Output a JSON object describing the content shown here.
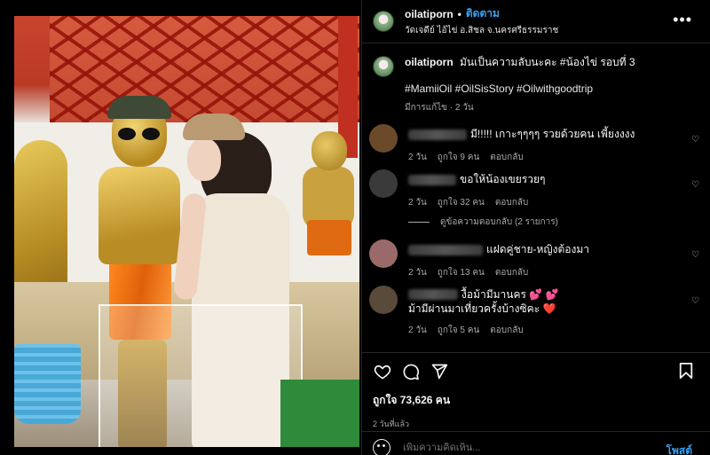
{
  "post": {
    "username": "oilatiporn",
    "follow_label": "ติดตาม",
    "location": "วัดเจดีย์ ไอ้ไข่ อ.สิชล จ.นครศรีธรรมราช",
    "more_icon": "more-horizontal-icon"
  },
  "caption": {
    "username": "oilatiporn",
    "text": "มันเป็นความลับนะคะ #น้องไข่ รอบที่ 3",
    "tags": "#MamiiOil #OilSisStory #Oilwithgoodtrip",
    "meta": "มีการแก้ไข · 2 วัน"
  },
  "comments": [
    {
      "text": "มี!!!!! เกาะๆๆๆๆ รวยด้วยคน เพี้ยงงงง",
      "time": "2 วัน",
      "likes": "ถูกใจ 9 คน",
      "reply": "ตอบกลับ",
      "avatar_color": "#6b4a2a"
    },
    {
      "text": "ขอให้น้องเขยรวยๆ",
      "time": "2 วัน",
      "likes": "ถูกใจ 32 คน",
      "reply": "ตอบกลับ",
      "avatar_color": "#3a3a3a"
    },
    {
      "text": "แฝดคู่ชาย-หญิงต้องมา",
      "time": "2 วัน",
      "likes": "ถูกใจ 13 คน",
      "reply": "ตอบกลับ",
      "avatar_color": "#9a6a6a"
    },
    {
      "text": "งื้อม้ามีมานคร",
      "emoji": "💕 💕",
      "text2": "ม้ามีผ่านมาเที่ยวครั้งบ้างซิคะ",
      "heart": "❤️",
      "time": "2 วัน",
      "likes": "ถูกใจ 5 คน",
      "reply": "ตอบกลับ",
      "avatar_color": "#5a4a3a"
    }
  ],
  "view_replies": "ดูข้อความตอบกลับ (2 รายการ)",
  "actions": {
    "icons": [
      "heart-icon",
      "comment-icon",
      "share-icon",
      "bookmark-icon"
    ],
    "likes": "ถูกใจ 73,626 คน",
    "date": "2 วันที่แล้ว"
  },
  "add_comment": {
    "placeholder": "เพิ่มความคิดเห็น...",
    "post_label": "โพสต์"
  },
  "colors": {
    "accent": "#3aa1f2",
    "background": "#000000"
  }
}
